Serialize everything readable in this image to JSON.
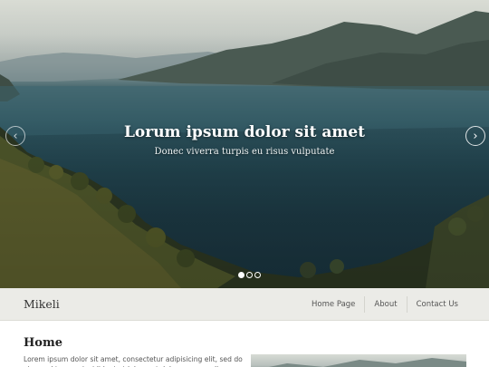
{
  "slider": {
    "title": "Lorum ipsum dolor sit amet",
    "subtitle": "Donec viverra turpis eu risus vulputate",
    "prev_icon": "‹",
    "next_icon": "›",
    "slide_count": 3,
    "active_slide": 1
  },
  "header": {
    "logo": "Mikeli",
    "nav": [
      {
        "label": "Home Page"
      },
      {
        "label": "About"
      },
      {
        "label": "Contact Us"
      }
    ]
  },
  "content": {
    "title": "Home",
    "text": "Lorem ipsum dolor sit amet, consectetur adipisicing elit, sed do eiusmod tempor incididunt ut labore et dolore magna aliqua."
  },
  "colors": {
    "header_bg": "#ebebe7",
    "lake": "#1f3f49",
    "text_dark": "#222222"
  }
}
